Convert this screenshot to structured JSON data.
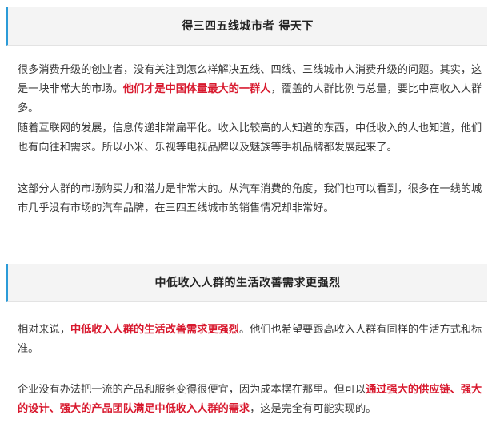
{
  "sections": [
    {
      "title": "得三四五线城市者 得天下",
      "paragraphs": [
        {
          "t1": "很多消费升级的创业者，没有关注到怎么样解决五线、四线、三线城市人消费升级的问题。其实，这是一块非常大的市场。",
          "hl1": "他们才是中国体量最大的一群人",
          "t2": "，覆盖的人群比例与总量，要比中高收入人群多。"
        },
        {
          "t1": "随着互联网的发展，信息传递非常扁平化。收入比较高的人知道的东西，中低收入的人也知道，他们也有向往和需求。所以小米、乐视等电视品牌以及魅族等手机品牌都发展起来了。"
        },
        {
          "t1": "这部分人群的市场购买力和潜力是非常大的。从汽车消费的角度，我们也可以看到，很多在一线的城市几乎没有市场的汽车品牌，在三四五线城市的销售情况却非常好。"
        }
      ]
    },
    {
      "title": "中低收入人群的生活改善需求更强烈",
      "paragraphs": [
        {
          "t1": "相对来说，",
          "hl1": "中低收入人群的生活改善需求更强烈",
          "t2": "。他们也希望要跟高收入人群有同样的生活方式和标准。"
        },
        {
          "t1": "企业没有办法把一流的产品和服务变得很便宜，因为成本摆在那里。但可以",
          "hl1": "通过强大的供应链、强大的设计、强大的产品团队满足中低收入人群的需求",
          "t2": "，这是完全有可能实现的。"
        }
      ]
    }
  ],
  "colors": {
    "accent_border": "#2b9bd8",
    "highlight_text": "#d8192e",
    "header_bg": "#f4f4f4"
  }
}
